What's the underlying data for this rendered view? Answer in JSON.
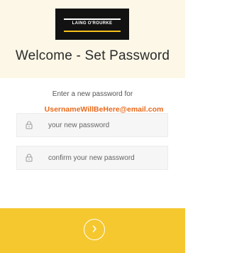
{
  "header": {
    "logo_text": "LAING O'ROURKE",
    "title": "Welcome - Set Password"
  },
  "prompt": {
    "instruction": "Enter a new password for",
    "email": "UsernameWillBeHere@email.com"
  },
  "form": {
    "new_password_placeholder": "your new password",
    "confirm_password_placeholder": "confirm your new password",
    "icon": "lock-icon"
  },
  "submit": {
    "icon": "chevron-right-icon"
  },
  "colors": {
    "header_bg": "#fcf7e7",
    "accent_orange": "#e86a1c",
    "footer_yellow": "#f5c82f",
    "logo_bg": "#121212"
  }
}
